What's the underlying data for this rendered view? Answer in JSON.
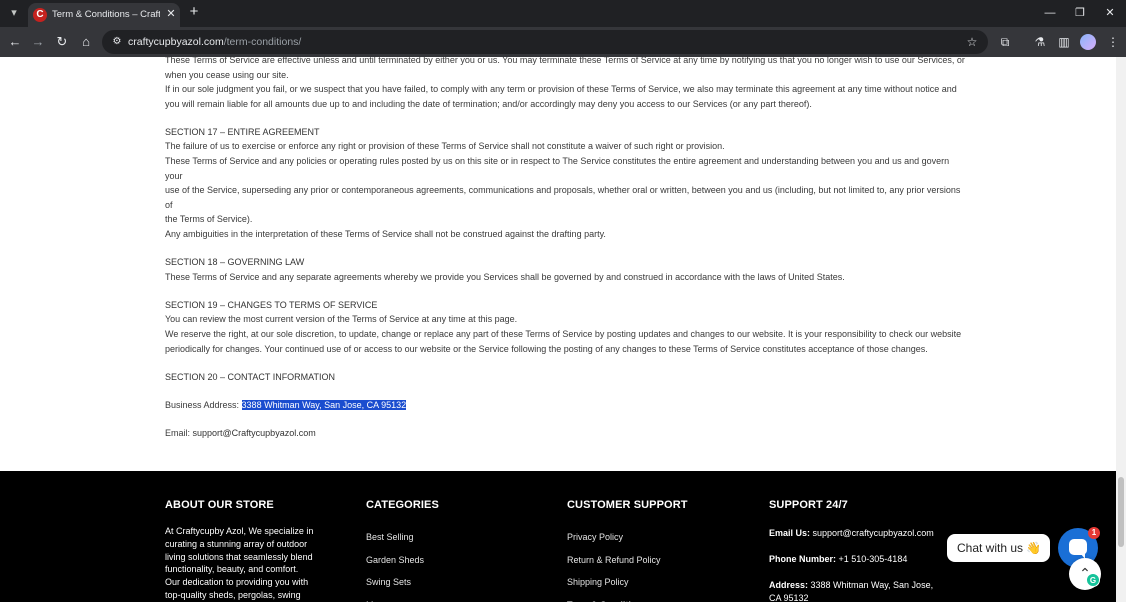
{
  "browser": {
    "tab_title": "Term & Conditions – Craftycupby Azol",
    "favicon_letter": "C",
    "url_host": "craftycupbyazol.com",
    "url_path": "/term-conditions/"
  },
  "content": {
    "lines": [
      "These Terms of Service are effective unless and until terminated by either you or us. You may terminate these Terms of Service at any time by notifying us that you no longer wish to use our Services, or",
      "when you cease using our site.",
      "If in our sole judgment you fail, or we suspect that you have failed, to comply with any term or provision of these Terms of Service, we also may terminate this agreement at any time without notice and",
      "you will remain liable for all amounts due up to and including the date of termination; and/or accordingly may deny you access to our Services (or any part thereof)."
    ],
    "sec17_title": "SECTION 17 – ENTIRE AGREEMENT",
    "sec17_lines": [
      "The failure of us to exercise or enforce any right or provision of these Terms of Service shall not constitute a waiver of such right or provision.",
      "These Terms of Service and any policies or operating rules posted by us on this site or in respect to The Service constitutes the entire agreement and understanding between you and us and govern your",
      "use of the Service, superseding any prior or contemporaneous agreements, communications and proposals, whether oral or written, between you and us (including, but not limited to, any prior versions of",
      "the Terms of Service).",
      "Any ambiguities in the interpretation of these Terms of Service shall not be construed against the drafting party."
    ],
    "sec18_title": "SECTION 18 – GOVERNING LAW",
    "sec18_lines": [
      "These Terms of Service and any separate agreements whereby we provide you Services shall be governed by and construed in accordance with the laws of United States."
    ],
    "sec19_title": "SECTION 19 – CHANGES TO TERMS OF SERVICE",
    "sec19_lines": [
      "You can review the most current version of the Terms of Service at any time at this page.",
      "We reserve the right, at our sole discretion, to update, change or replace any part of these Terms of Service by posting updates and changes to our website. It is your responsibility to check our website",
      "periodically for changes. Your continued use of or access to our website or the Service following the posting of any changes to these Terms of Service constitutes acceptance of those changes."
    ],
    "sec20_title": "SECTION 20 – CONTACT INFORMATION",
    "address_label": "Business Address: ",
    "address_value": "3388 Whitman Way, San Jose, CA 95132",
    "email_label": "Email: ",
    "email_value": "support@Craftycupbyazol.com"
  },
  "footer": {
    "about_title": "ABOUT OUR STORE",
    "about_text": "At Craftycupby Azol, We specialize in curating a stunning array of outdoor living solutions that seamlessly blend functionality, beauty, and comfort. Our dedication to providing you with top-quality sheds, pergolas, swing sets,",
    "categories_title": "CATEGORIES",
    "categories": [
      "Best Selling",
      "Garden Sheds",
      "Swing Sets",
      "Mowers"
    ],
    "support_title": "CUSTOMER SUPPORT",
    "support_links": [
      "Privacy Policy",
      "Return & Refund Policy",
      "Shipping Policy",
      "Term & Conditions"
    ],
    "support247_title": "SUPPORT 24/7",
    "email_label": "Email Us:",
    "email_value": " support@craftycupbyazol.com",
    "phone_label": "Phone Number:",
    "phone_value": " +1 510-305-4184",
    "address_label": "Address:",
    "address_value": " 3388 Whitman Way, San Jose, CA 95132"
  },
  "chat": {
    "bubble_text": "Chat with us 👋",
    "badge_count": "1"
  }
}
